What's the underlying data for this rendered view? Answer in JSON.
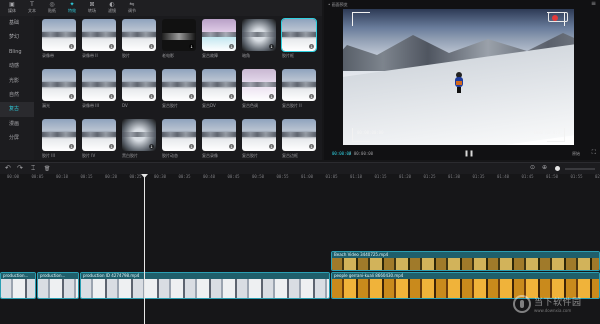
{
  "toolbar": {
    "items": [
      {
        "icon": "media-icon",
        "label": "媒体",
        "glyph": "▣"
      },
      {
        "icon": "text-icon",
        "label": "文本",
        "glyph": "T"
      },
      {
        "icon": "sticker-icon",
        "label": "贴纸",
        "glyph": "◎"
      },
      {
        "icon": "effects-icon",
        "label": "特效",
        "glyph": "✦",
        "active": true
      },
      {
        "icon": "transition-icon",
        "label": "转场",
        "glyph": "⊠"
      },
      {
        "icon": "filter-icon",
        "label": "滤镜",
        "glyph": "◐"
      },
      {
        "icon": "adjust-icon",
        "label": "调节",
        "glyph": "⇋"
      }
    ]
  },
  "sidebar": {
    "categories": [
      {
        "label": "基础"
      },
      {
        "label": "梦幻"
      },
      {
        "label": "Bling"
      },
      {
        "label": "动感"
      },
      {
        "label": "光影"
      },
      {
        "label": "自然"
      },
      {
        "label": "复古",
        "active": true
      },
      {
        "label": "漫画"
      },
      {
        "label": "分屏"
      }
    ]
  },
  "effects": [
    {
      "label": "录像带",
      "style": ""
    },
    {
      "label": "录像带 II",
      "style": ""
    },
    {
      "label": "胶片",
      "style": ""
    },
    {
      "label": "老电影",
      "style": "dark"
    },
    {
      "label": "复古故障",
      "style": "glitch"
    },
    {
      "label": "暗角",
      "style": "vignette"
    },
    {
      "label": "胶片框",
      "style": "",
      "selected": true
    },
    {
      "label": "漏光",
      "style": ""
    },
    {
      "label": "录像带 III",
      "style": ""
    },
    {
      "label": "DV",
      "style": ""
    },
    {
      "label": "复古胶片",
      "style": ""
    },
    {
      "label": "复古DV",
      "style": ""
    },
    {
      "label": "复古色调",
      "style": "tint"
    },
    {
      "label": "复古胶片 II",
      "style": ""
    },
    {
      "label": "胶片 III",
      "style": ""
    },
    {
      "label": "胶片 IV",
      "style": ""
    },
    {
      "label": "黑白胶片",
      "style": "vignette"
    },
    {
      "label": "胶片动态",
      "style": ""
    },
    {
      "label": "复古录像",
      "style": ""
    },
    {
      "label": "复古胶片",
      "style": ""
    },
    {
      "label": "复古边框",
      "style": ""
    }
  ],
  "preview": {
    "title": "• 画面预览",
    "menu_glyph": "≡",
    "vf_left_text": "00:00:00:00",
    "vf_right_text": "1080 HD 4:3",
    "time_current": "00:00:00",
    "time_total": "/ 00:00:00",
    "play_glyph": "❚❚",
    "ratio": "原始",
    "fullscreen_glyph": "⛶"
  },
  "timeline": {
    "tools": {
      "undo": "↶",
      "redo": "↷",
      "split": "⌶",
      "delete": "🗑"
    },
    "right_tools": {
      "magnet": "⊙",
      "link": "⊕",
      "preview": "⊟"
    },
    "ruler": [
      "00:00",
      "00:05",
      "00:10",
      "00:15",
      "00:20",
      "00:25",
      "00:30",
      "00:35",
      "00:40",
      "00:45",
      "00:50",
      "00:55",
      "01:00",
      "01:05",
      "01:10",
      "01:15",
      "01:20",
      "01:25",
      "01:30",
      "01:35",
      "01:40",
      "01:45",
      "01:50",
      "01:55",
      "02:00"
    ],
    "clips": {
      "upper": "Beach Video 3440725.mp4",
      "main1": "production...",
      "main2": "production...",
      "main3": "production ID 4274798.mp4",
      "main4": "people gerrani-kuali 8660430.mp4"
    }
  },
  "watermark": {
    "text": "当下软件园",
    "sub": "www.downxia.com"
  }
}
